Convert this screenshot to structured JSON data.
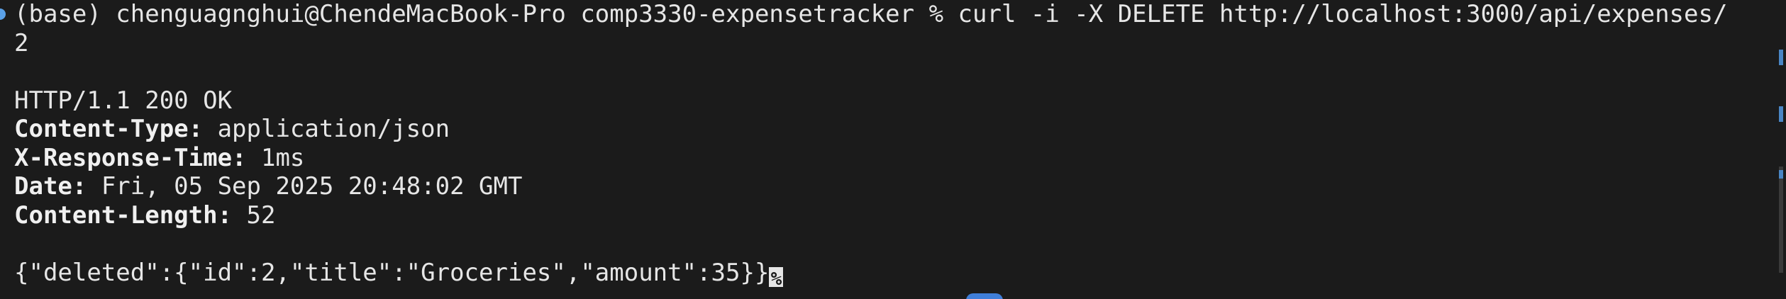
{
  "terminal": {
    "command_line": "(base) chenguagnghui@ChendeMacBook-Pro comp3330-expensetracker % curl -i -X DELETE http://localhost:3000/api/expenses/",
    "command_wrap": "2",
    "status_line": "HTTP/1.1 200 OK",
    "headers": [
      {
        "key": "Content-Type:",
        "value": " application/json"
      },
      {
        "key": "X-Response-Time:",
        "value": " 1ms"
      },
      {
        "key": "Date:",
        "value": " Fri, 05 Sep 2025 20:48:02 GMT"
      },
      {
        "key": "Content-Length:",
        "value": " 52"
      }
    ],
    "body_line": "{\"deleted\":{\"id\":2,\"title\":\"Groceries\",\"amount\":35}}",
    "end_marker": "%"
  },
  "colors": {
    "background": "#1b1b1b",
    "foreground": "#e6e6e6",
    "accent": "#4a86c5"
  }
}
